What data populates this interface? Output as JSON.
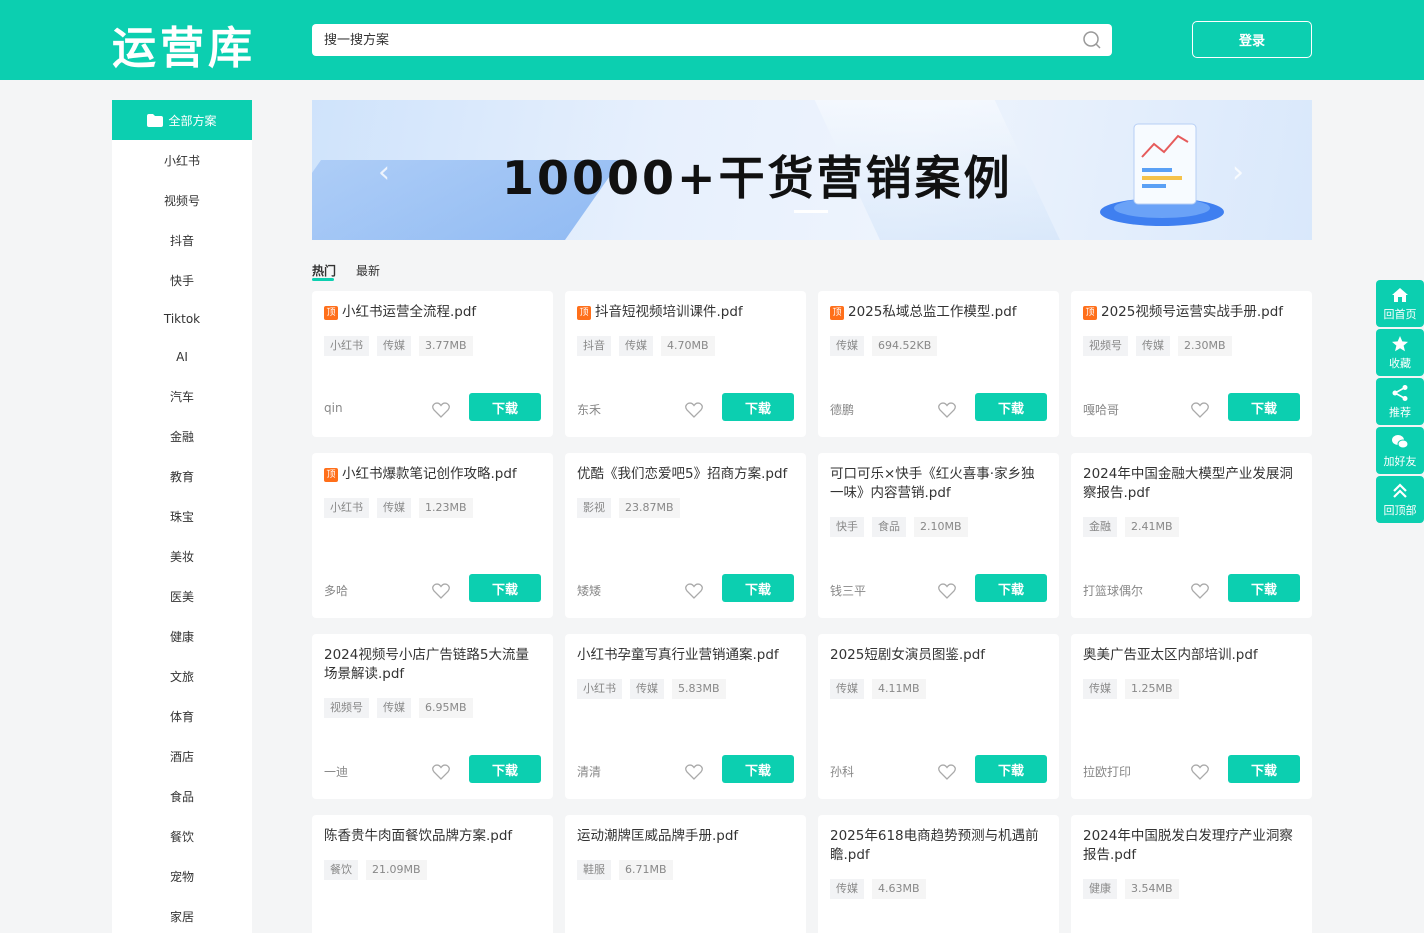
{
  "header": {
    "logo": "运营库",
    "search_placeholder": "搜一搜方案",
    "login_label": "登录"
  },
  "sidebar": {
    "active_label": "全部方案",
    "items": [
      "小红书",
      "视频号",
      "抖音",
      "快手",
      "Tiktok",
      "AI",
      "汽车",
      "金融",
      "教育",
      "珠宝",
      "美妆",
      "医美",
      "健康",
      "文旅",
      "体育",
      "酒店",
      "食品",
      "餐饮",
      "宠物",
      "家居"
    ]
  },
  "banner": {
    "title": "10000+干货营销案例"
  },
  "tabs": [
    "热门",
    "最新"
  ],
  "download_label": "下载",
  "hot_badge": "顶",
  "cards": [
    {
      "title": "小红书运营全流程.pdf",
      "hot": true,
      "tags": [
        "小红书",
        "传媒"
      ],
      "size": "3.77MB",
      "author": "qin"
    },
    {
      "title": "抖音短视频培训课件.pdf",
      "hot": true,
      "tags": [
        "抖音",
        "传媒"
      ],
      "size": "4.70MB",
      "author": "东禾"
    },
    {
      "title": "2025私域总监工作模型.pdf",
      "hot": true,
      "tags": [
        "传媒"
      ],
      "size": "694.52KB",
      "author": "德鹏"
    },
    {
      "title": "2025视频号运营实战手册.pdf",
      "hot": true,
      "tags": [
        "视频号",
        "传媒"
      ],
      "size": "2.30MB",
      "author": "嘎哈哥"
    },
    {
      "title": "小红书爆款笔记创作攻略.pdf",
      "hot": true,
      "tags": [
        "小红书",
        "传媒"
      ],
      "size": "1.23MB",
      "author": "多哈"
    },
    {
      "title": "优酷《我们恋爱吧5》招商方案.pdf",
      "hot": false,
      "tags": [
        "影视"
      ],
      "size": "23.87MB",
      "author": "矮矮"
    },
    {
      "title": "可口可乐×快手《红火喜事·家乡独一味》内容营销.pdf",
      "hot": false,
      "tags": [
        "快手",
        "食品"
      ],
      "size": "2.10MB",
      "author": "钱三平"
    },
    {
      "title": "2024年中国金融大模型产业发展洞察报告.pdf",
      "hot": false,
      "tags": [
        "金融"
      ],
      "size": "2.41MB",
      "author": "打篮球偶尔"
    },
    {
      "title": "2024视频号小店广告链路5大流量场景解读.pdf",
      "hot": false,
      "tags": [
        "视频号",
        "传媒"
      ],
      "size": "6.95MB",
      "author": "一迪"
    },
    {
      "title": "小红书孕童写真行业营销通案.pdf",
      "hot": false,
      "tags": [
        "小红书",
        "传媒"
      ],
      "size": "5.83MB",
      "author": "清清"
    },
    {
      "title": "2025短剧女演员图鉴.pdf",
      "hot": false,
      "tags": [
        "传媒"
      ],
      "size": "4.11MB",
      "author": "孙科"
    },
    {
      "title": "奥美广告亚太区内部培训.pdf",
      "hot": false,
      "tags": [
        "传媒"
      ],
      "size": "1.25MB",
      "author": "拉欧打印"
    },
    {
      "title": "陈香贵牛肉面餐饮品牌方案.pdf",
      "hot": false,
      "tags": [
        "餐饮"
      ],
      "size": "21.09MB",
      "author": ""
    },
    {
      "title": "运动潮牌匡威品牌手册.pdf",
      "hot": false,
      "tags": [
        "鞋服"
      ],
      "size": "6.71MB",
      "author": ""
    },
    {
      "title": "2025年618电商趋势预测与机遇前瞻.pdf",
      "hot": false,
      "tags": [
        "传媒"
      ],
      "size": "4.63MB",
      "author": ""
    },
    {
      "title": "2024年中国脱发白发理疗产业洞察报告.pdf",
      "hot": false,
      "tags": [
        "健康"
      ],
      "size": "3.54MB",
      "author": ""
    }
  ],
  "float_bar": [
    {
      "label": "回首页",
      "icon": "home-icon"
    },
    {
      "label": "收藏",
      "icon": "star-icon"
    },
    {
      "label": "推荐",
      "icon": "share-icon"
    },
    {
      "label": "加好友",
      "icon": "wechat-icon"
    },
    {
      "label": "回顶部",
      "icon": "arrow-up-icon"
    }
  ],
  "colors": {
    "accent": "#0ccfb0",
    "hot_badge": "#ff6f1a"
  }
}
